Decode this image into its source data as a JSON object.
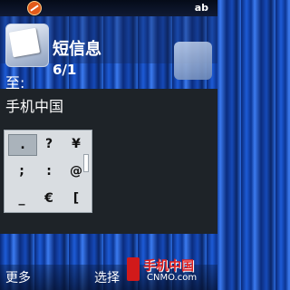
{
  "status": {
    "input_mode": "ab"
  },
  "header": {
    "title": "短信息",
    "counter": "6/1"
  },
  "recipient": {
    "label": "至:"
  },
  "message": {
    "text": "手机中国"
  },
  "symbol_grid": {
    "rows": [
      [
        ".",
        "?",
        "¥"
      ],
      [
        ";",
        ":",
        "@"
      ],
      [
        "_",
        "€",
        "["
      ]
    ],
    "selected": "."
  },
  "softkeys": {
    "left": "更多",
    "center": "选择"
  },
  "watermark": {
    "main": "手机中国",
    "sub": "CNMO.com"
  }
}
